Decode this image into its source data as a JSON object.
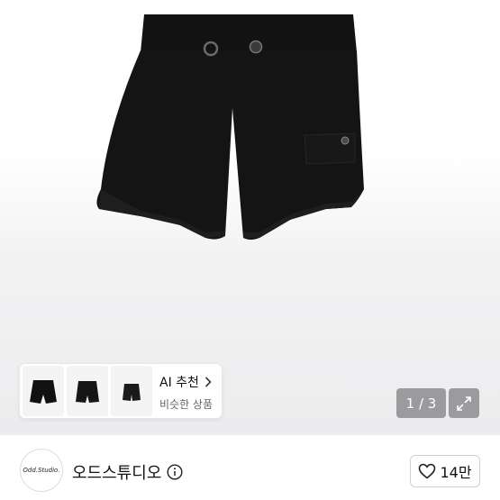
{
  "product_image": {
    "description_icon": "black-shorts-image"
  },
  "ai_recommend": {
    "title": "AI 추천",
    "subtitle": "비슷한 상품",
    "chevron_icon": "chevron-right-icon"
  },
  "gallery": {
    "counter": "1 / 3",
    "expand_icon": "expand-icon"
  },
  "seller": {
    "avatar_text": "Odd.Studio.",
    "name": "오드스튜디오",
    "info_icon": "info-icon"
  },
  "like": {
    "count": "14만",
    "icon": "heart-icon"
  }
}
